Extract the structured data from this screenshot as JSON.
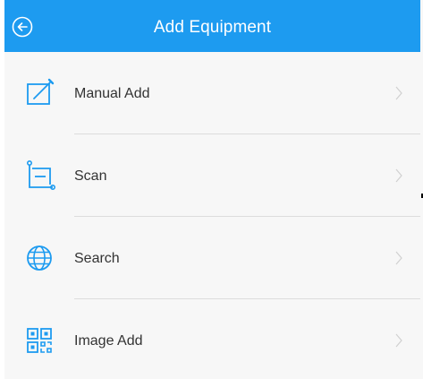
{
  "header": {
    "title": "Add Equipment",
    "back_icon": "back-arrow-circle-icon",
    "background_color": "#1d9bf0"
  },
  "menu": {
    "items": [
      {
        "label": "Manual Add",
        "icon": "edit-icon"
      },
      {
        "label": "Scan",
        "icon": "scan-icon"
      },
      {
        "label": "Search",
        "icon": "globe-icon"
      },
      {
        "label": "Image Add",
        "icon": "qr-code-icon"
      }
    ],
    "accent_color": "#1d9bf0",
    "chevron_icon": "chevron-right-icon"
  }
}
